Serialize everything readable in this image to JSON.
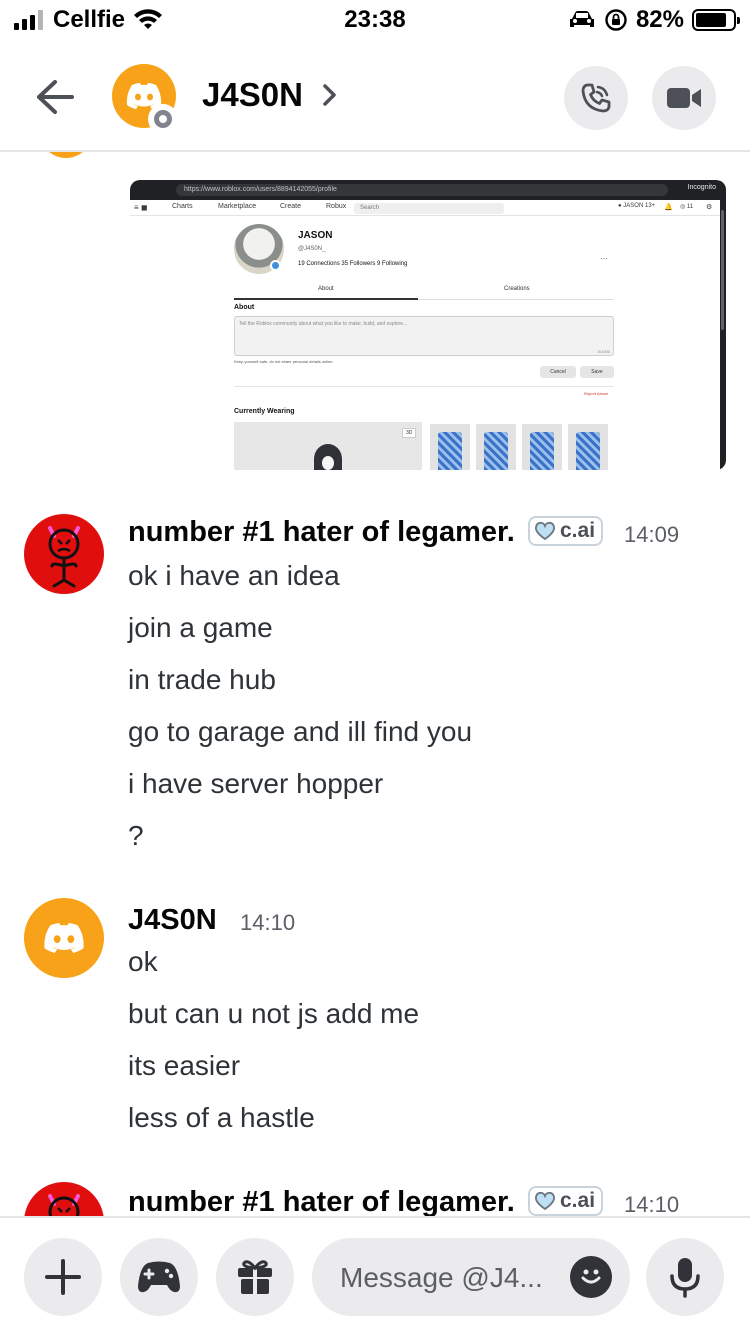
{
  "status_bar": {
    "carrier": "Cellfie",
    "time": "23:38",
    "battery": "82%",
    "battery_level": 0.82,
    "icons": [
      "signal-icon",
      "wifi-icon",
      "car-icon",
      "rotation-lock-icon",
      "battery-icon"
    ]
  },
  "header": {
    "contact_name": "J4S0N",
    "icons": [
      "back-arrow-icon",
      "discord-logo-icon",
      "chevron-right-icon",
      "voice-call-icon",
      "video-call-icon"
    ]
  },
  "attachment": {
    "url": "https://www.roblox.com/users/8894142055/profile",
    "incognito": "Incognito",
    "nav": [
      "Charts",
      "Marketplace",
      "Create",
      "Robux"
    ],
    "search_placeholder": "Search",
    "header_user": "JASON",
    "header_user_badge": "13+",
    "robux_count": "11",
    "profile_name": "JASON",
    "profile_handle": "@J4S0N_",
    "stats": "19 Connections   35 Followers   9 Following",
    "tab_about": "About",
    "tab_creations": "Creations",
    "about_heading": "About",
    "about_placeholder": "Tell the Roblox community about what you like to make, build, and explore...",
    "char_count": "0/1000",
    "disclaimer": "Keep yourself safe, do not share personal details online.",
    "cancel": "Cancel",
    "save": "Save",
    "report": "Report Abuse",
    "currently_wearing": "Currently Wearing",
    "three_d": "3D"
  },
  "messages": [
    {
      "author": "number #1 hater of legamer.",
      "badge": "c.ai",
      "time": "14:09",
      "lines": [
        "ok i have an idea",
        "join a game",
        "in trade hub",
        "go to garage and ill find you",
        "i have server hopper",
        "?"
      ]
    },
    {
      "author": "J4S0N",
      "time": "14:10",
      "lines": [
        "ok",
        "but can u not js add me",
        "its easier",
        "less of a hastle"
      ]
    },
    {
      "author": "number #1 hater of legamer.",
      "badge": "c.ai",
      "time": "14:10"
    }
  ],
  "composer": {
    "placeholder": "Message @J4...",
    "icons": [
      "plus-icon",
      "gamepad-icon",
      "gift-icon",
      "emoji-icon",
      "microphone-icon"
    ]
  },
  "colors": {
    "discord_avatar": "#f7a219",
    "devil_avatar": "#e10e0e",
    "text_primary": "#060607",
    "text_message": "#2e3338",
    "button_bg": "#ebebed"
  }
}
